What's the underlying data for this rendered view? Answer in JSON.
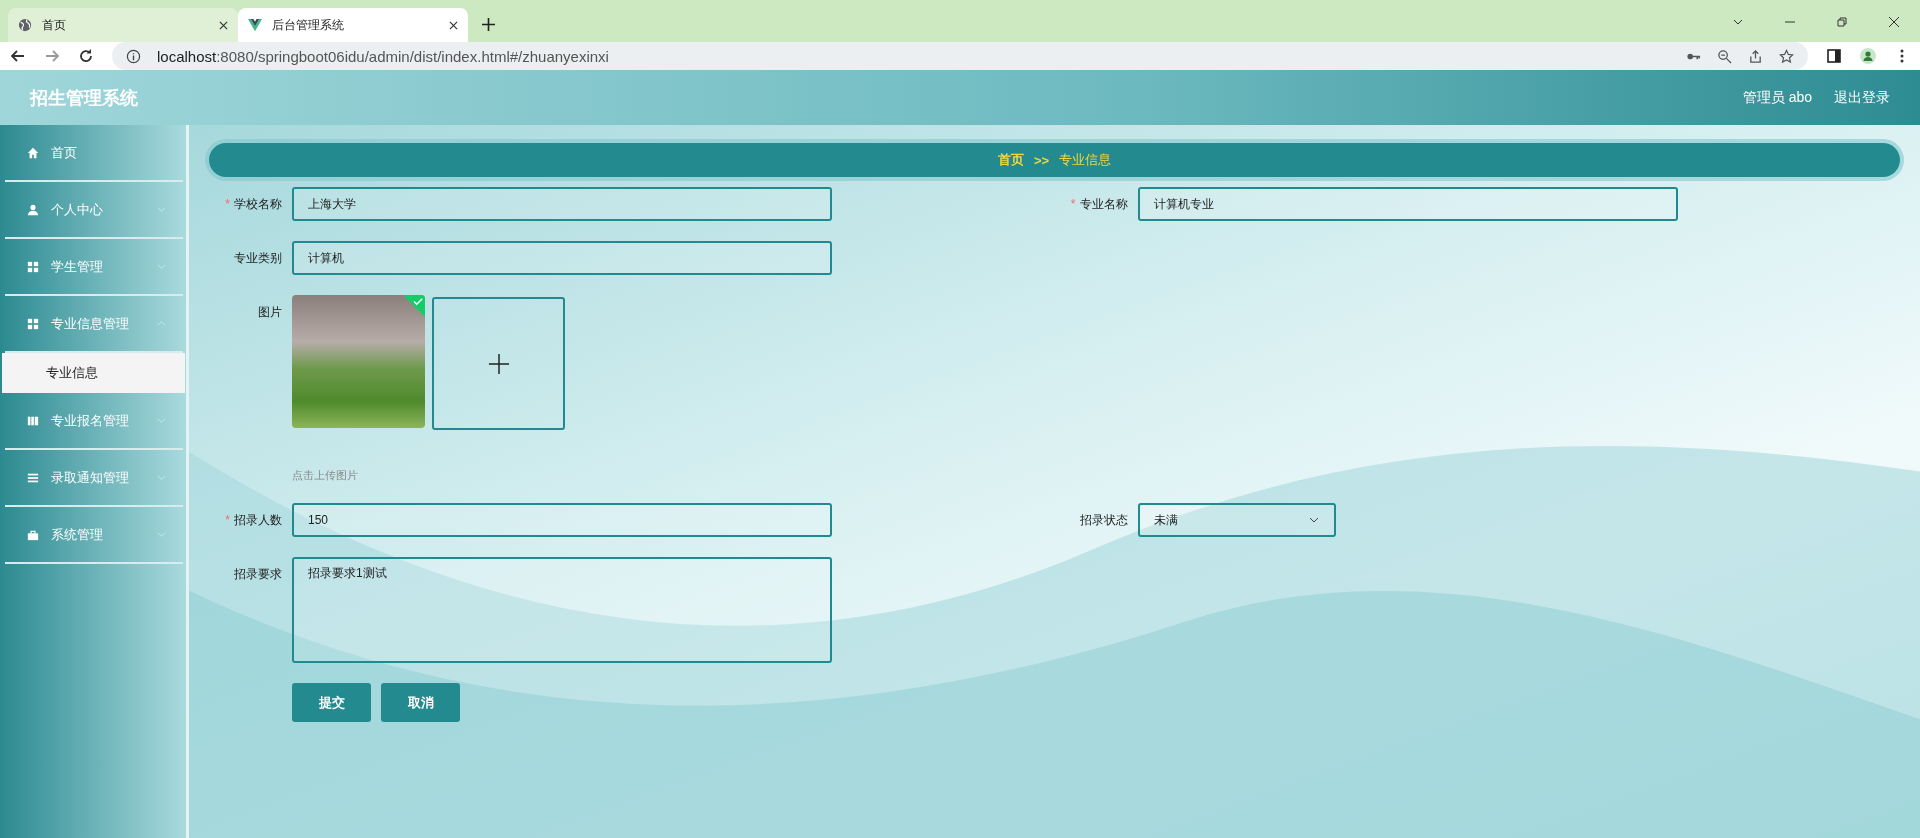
{
  "browser": {
    "tabs": [
      {
        "title": "首页",
        "kind": "globe",
        "selected": false
      },
      {
        "title": "后台管理系统",
        "kind": "vue",
        "selected": true
      }
    ],
    "url_host": "localhost",
    "url_rest": ":8080/springboot06idu/admin/dist/index.html#/zhuanyexinxi"
  },
  "header": {
    "title": "招生管理系统",
    "user": "管理员 abo",
    "logout": "退出登录"
  },
  "sidebar": {
    "items": [
      {
        "label": "首页",
        "kind": "home"
      },
      {
        "label": "个人中心",
        "kind": "user",
        "expanded": false
      },
      {
        "label": "学生管理",
        "kind": "grid",
        "expanded": false
      },
      {
        "label": "专业信息管理",
        "kind": "grid",
        "expanded": true,
        "children": [
          {
            "label": "专业信息",
            "selected": true
          }
        ]
      },
      {
        "label": "专业报名管理",
        "kind": "book",
        "expanded": false
      },
      {
        "label": "录取通知管理",
        "kind": "list",
        "expanded": false
      },
      {
        "label": "系统管理",
        "kind": "case",
        "expanded": false
      }
    ]
  },
  "breadcrumb": {
    "items": [
      "首页",
      "专业信息"
    ],
    "separator": ">>"
  },
  "form": {
    "rows": [
      [
        {
          "label": "学校名称",
          "required_mark": "*",
          "kind": "text",
          "value": "上海大学"
        },
        {
          "label": "专业名称",
          "required_mark": "*",
          "kind": "text",
          "value": "计算机专业"
        }
      ],
      [
        {
          "label": "专业类别",
          "kind": "text",
          "value": "计算机"
        }
      ],
      [
        {
          "label": "图片",
          "kind": "image",
          "uploaded": true,
          "hint": "点击上传图片"
        }
      ],
      [
        {
          "label": "招录人数",
          "required_mark": "*",
          "kind": "text",
          "value": "150"
        },
        {
          "label": "招录状态",
          "kind": "select",
          "value": "未满"
        }
      ],
      [
        {
          "label": "招录要求",
          "kind": "textarea",
          "value": "招录要求1测试"
        }
      ]
    ],
    "buttons": [
      "提交",
      "取消"
    ]
  }
}
